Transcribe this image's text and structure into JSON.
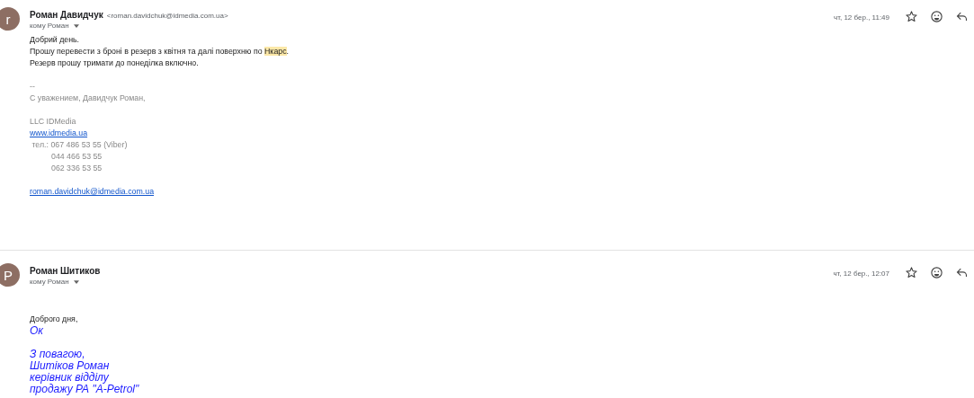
{
  "messages": [
    {
      "avatar": "r",
      "sender": "Роман Давидчук",
      "email": "<roman.davidchuk@idmedia.com.ua>",
      "recipient": "кому Роман",
      "date": "чт, 12 бер., 11:49",
      "lines": [
        {
          "kind": "plain",
          "parts": [
            {
              "text": "Добрий день.",
              "highlight": false
            }
          ]
        },
        {
          "kind": "plain",
          "parts": [
            {
              "text": "Прошу перевести з броні в резерв з квітня та далі поверхню по ",
              "highlight": false
            },
            {
              "text": "Нкарс",
              "highlight": true
            },
            {
              "text": ".",
              "highlight": false
            }
          ]
        },
        {
          "kind": "plain",
          "parts": [
            {
              "text": "Резерв прошу тримати до понеділка включно.",
              "highlight": false
            }
          ]
        },
        {
          "kind": "gap"
        },
        {
          "kind": "muted",
          "indented": false,
          "text": "--"
        },
        {
          "kind": "muted",
          "indented": false,
          "text": "С уважением, Давидчук Роман,"
        },
        {
          "kind": "gap"
        },
        {
          "kind": "muted",
          "indented": false,
          "text": "LLC IDMedia"
        },
        {
          "kind": "link",
          "text": "www.idmedia.ua"
        },
        {
          "kind": "muted",
          "indented": false,
          "text": " тел.: 067 486 53 55 (Viber)"
        },
        {
          "kind": "muted",
          "indented": true,
          "text": "044 466 53 55"
        },
        {
          "kind": "muted",
          "indented": true,
          "text": "062 336 53 55"
        },
        {
          "kind": "gap"
        },
        {
          "kind": "link",
          "text": "roman.davidchuk@idmedia.com.ua"
        }
      ]
    },
    {
      "avatar": "Р",
      "sender": "Роман Шитиков",
      "recipient": "кому Роман",
      "date": "чт, 12 бер., 12:07",
      "lines": [
        {
          "kind": "plain",
          "parts": [
            {
              "text": "Доброго дня,",
              "highlight": false
            }
          ]
        },
        {
          "kind": "blue",
          "text": "Ок"
        },
        {
          "kind": "gap"
        },
        {
          "kind": "blue",
          "text": "З повагою,"
        },
        {
          "kind": "blue",
          "text": "Шитіков Роман"
        },
        {
          "kind": "blue",
          "text": "керівник відділу"
        },
        {
          "kind": "blue",
          "text": "продажу РА \"A-Petrol\""
        }
      ]
    }
  ]
}
